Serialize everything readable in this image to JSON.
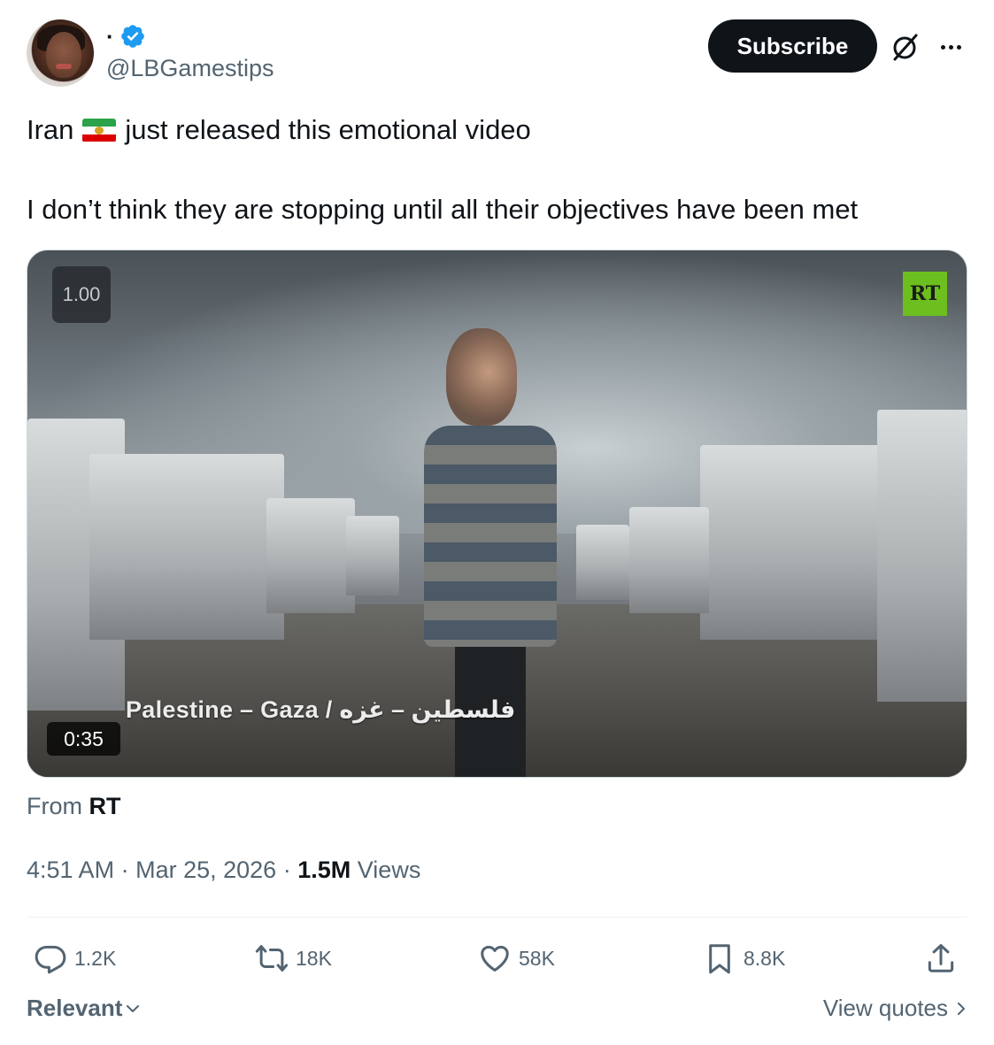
{
  "author": {
    "display_name": "·",
    "handle": "@LBGamestips",
    "avatar_icon": "user-avatar",
    "verified_icon": "verified-badge-icon",
    "verified_color": "#1d9bf0"
  },
  "header": {
    "subscribe_label": "Subscribe",
    "grok_icon": "grok-icon",
    "more_icon": "more-dots-icon"
  },
  "tweet": {
    "line1_before": "Iran",
    "flag_icon": "iran-flag-emoji",
    "line1_after": "just released this emotional video",
    "line2": "I don’t think they are stopping until all their objectives have been met"
  },
  "media": {
    "speed_label": "1.00",
    "logo_text": "RT",
    "logo_color": "#6cbf1e",
    "caption": "Palestine – Gaza / فلسطين – غزه",
    "duration": "0:35"
  },
  "source": {
    "from_label": "From",
    "from_name": "RT"
  },
  "meta": {
    "time": "4:51 AM",
    "separator": "·",
    "date": "Mar 25, 2026",
    "views_count": "1.5M",
    "views_label": "Views"
  },
  "actions": {
    "replies": "1.2K",
    "reposts": "18K",
    "likes": "58K",
    "bookmarks": "8.8K"
  },
  "footer": {
    "sort_label": "Relevant",
    "view_quotes_label": "View quotes"
  },
  "colors": {
    "text_primary": "#0f1419",
    "text_secondary": "#536471",
    "divider": "#eff3f4"
  }
}
